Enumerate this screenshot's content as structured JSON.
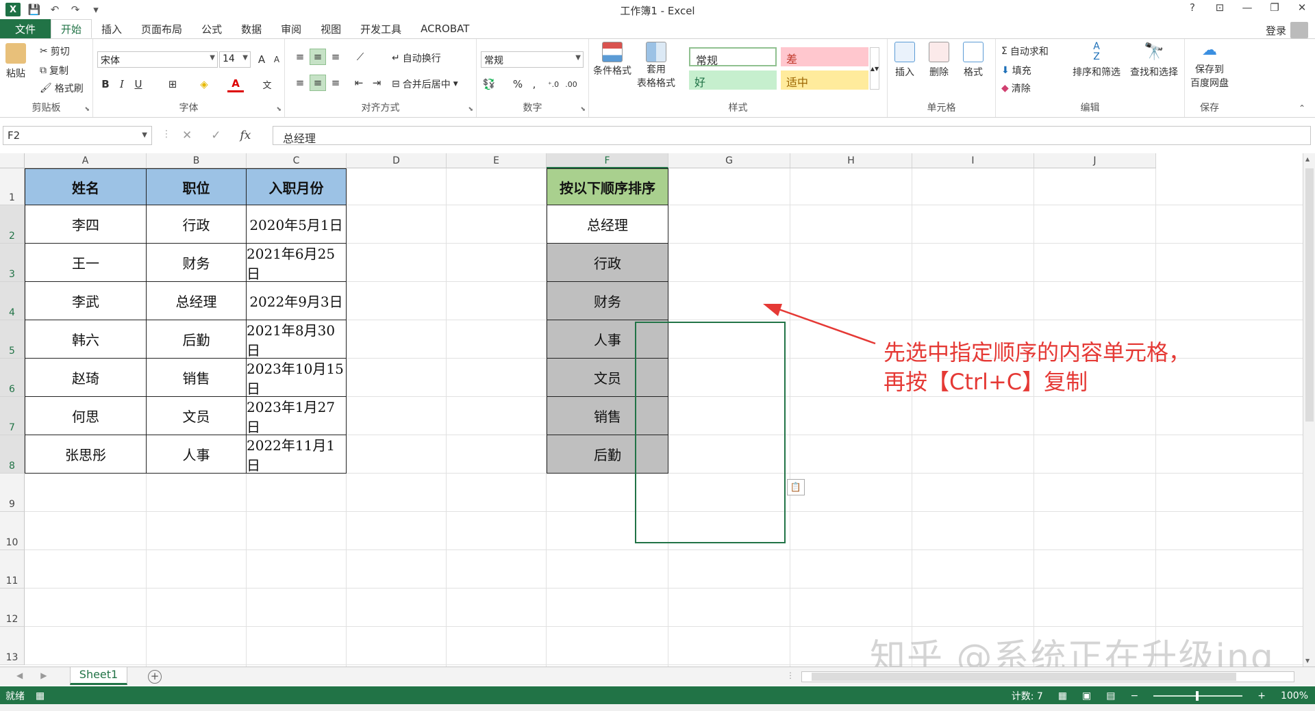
{
  "app": {
    "title": "工作簿1 - Excel",
    "login": "登录"
  },
  "qat": {
    "undo": "↶",
    "redo": "↷",
    "save": "💾",
    "more": "▾"
  },
  "tabs": [
    "文件",
    "开始",
    "插入",
    "页面布局",
    "公式",
    "数据",
    "审阅",
    "视图",
    "开发工具",
    "ACROBAT"
  ],
  "ribbon": {
    "clipboard": {
      "paste": "粘贴",
      "cut": "剪切",
      "copy": "复制",
      "format_painter": "格式刷",
      "label": "剪贴板"
    },
    "font": {
      "name": "宋体",
      "size": "14",
      "label": "字体",
      "bold": "B",
      "italic": "I",
      "underline": "U",
      "grow": "A",
      "shrink": "A",
      "font_color": "A"
    },
    "alignment": {
      "wrap": "自动换行",
      "merge": "合并后居中",
      "label": "对齐方式"
    },
    "number": {
      "format": "常规",
      "percent": "%",
      "comma": ",",
      "label": "数字"
    },
    "styles": {
      "conditional": "条件格式",
      "table": "套用",
      "table2": "表格格式",
      "normal": "常规",
      "bad": "差",
      "good": "好",
      "neutral": "适中",
      "label": "样式"
    },
    "cells": {
      "insert": "插入",
      "delete": "删除",
      "format": "格式",
      "label": "单元格"
    },
    "editing": {
      "autosum": "自动求和",
      "fill": "填充",
      "clear": "清除",
      "sort": "排序和筛选",
      "find": "查找和选择",
      "label": "编辑"
    },
    "save": {
      "line1": "保存到",
      "line2": "百度网盘",
      "label": "保存"
    }
  },
  "formula_bar": {
    "name_box": "F2",
    "fx": "fx",
    "value": "总经理"
  },
  "columns": [
    "A",
    "B",
    "C",
    "D",
    "E",
    "F",
    "G",
    "H",
    "I",
    "J"
  ],
  "rows": [
    "1",
    "2",
    "3",
    "4",
    "5",
    "6",
    "7",
    "8",
    "9",
    "10",
    "11",
    "12",
    "13"
  ],
  "table": {
    "headers": [
      "姓名",
      "职位",
      "入职月份"
    ],
    "rows": [
      [
        "李四",
        "行政",
        "2020年5月1日"
      ],
      [
        "王一",
        "财务",
        "2021年6月25日"
      ],
      [
        "李武",
        "总经理",
        "2022年9月3日"
      ],
      [
        "韩六",
        "后勤",
        "2021年8月30日"
      ],
      [
        "赵琦",
        "销售",
        "2023年10月15日"
      ],
      [
        "何思",
        "文员",
        "2023年1月27日"
      ],
      [
        "张思彤",
        "人事",
        "2022年11月1日"
      ]
    ]
  },
  "order_list": {
    "header": "按以下顺序排序",
    "items": [
      "总经理",
      "行政",
      "财务",
      "人事",
      "文员",
      "销售",
      "后勤"
    ]
  },
  "annotation": {
    "line1": "先选中指定顺序的内容单元格，",
    "line2": "再按【Ctrl+C】复制"
  },
  "watermark": "知乎 @系统正在升级ing",
  "sheet": {
    "name": "Sheet1",
    "add": "+"
  },
  "status": {
    "ready": "就绪",
    "count": "计数: 7",
    "zoom": "100%",
    "zoom_minus": "−",
    "zoom_plus": "+"
  },
  "colors": {
    "excel_green": "#217346",
    "header_blue": "#9cc2e5",
    "header_green": "#a9d08e",
    "gray_fill": "#bfbfbf",
    "annotation_red": "#e53935"
  }
}
